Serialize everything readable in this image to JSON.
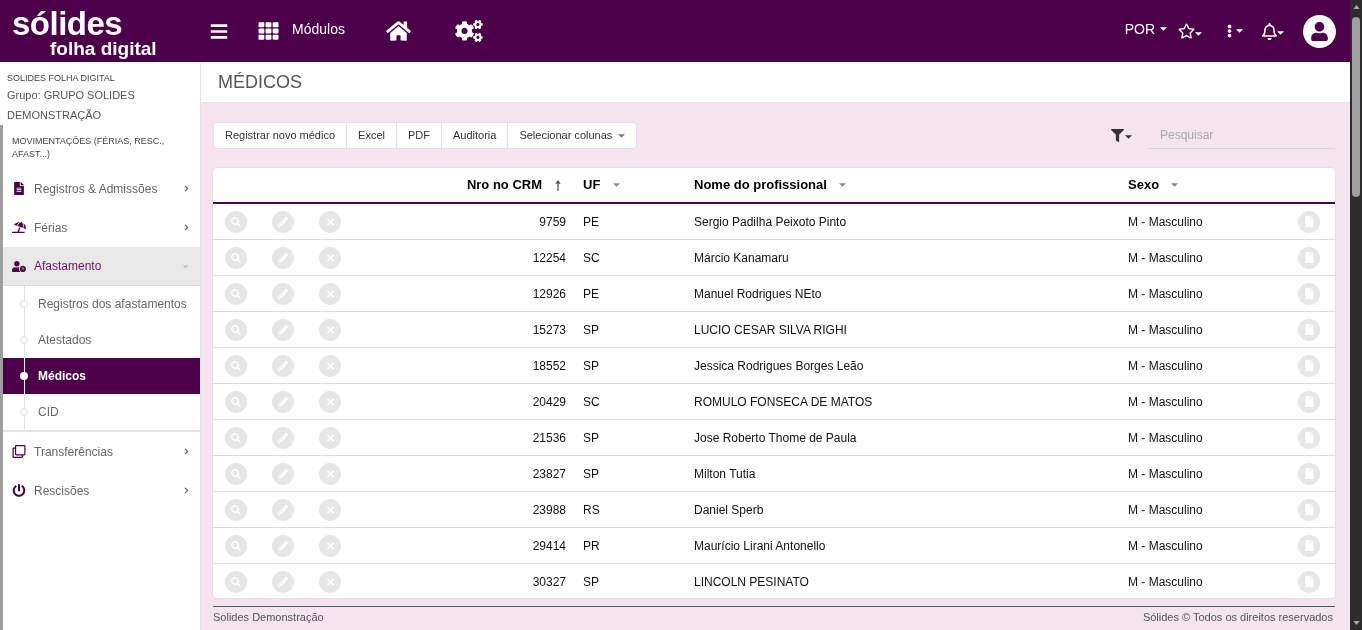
{
  "header": {
    "logo": {
      "name": "sólides",
      "tagline": "folha digital"
    },
    "modules_label": "Módulos",
    "language": "POR"
  },
  "sidebar": {
    "app_name": "SOLIDES FOLHA DIGITAL",
    "group": "Grupo: GRUPO SOLIDES DEMONSTRAÇÃO",
    "section": "MOVIMENTAÇÕES (FÉRIAS, RESC., AFAST...)",
    "items": [
      {
        "label": "Registros & Admissões",
        "expanded": false
      },
      {
        "label": "Férias",
        "expanded": false
      },
      {
        "label": "Afastamento",
        "expanded": true,
        "children": [
          {
            "label": "Registros dos afastamentos",
            "selected": false
          },
          {
            "label": "Atestados",
            "selected": false
          },
          {
            "label": "Médicos",
            "selected": true
          },
          {
            "label": "CID",
            "selected": false
          }
        ]
      },
      {
        "label": "Transferências",
        "expanded": false
      },
      {
        "label": "Rescisões",
        "expanded": false
      }
    ]
  },
  "page": {
    "title": "MÉDICOS"
  },
  "toolbar": {
    "buttons": [
      {
        "label": "Registrar novo médico",
        "kind": "button"
      },
      {
        "label": "Excel",
        "kind": "button"
      },
      {
        "label": "PDF",
        "kind": "button"
      },
      {
        "label": "Auditoria",
        "kind": "button"
      },
      {
        "label": "Selecionar colunas",
        "kind": "dropdown"
      }
    ],
    "search": {
      "placeholder": "Pesquisar"
    }
  },
  "table": {
    "columns": [
      {
        "label": "Nro no CRM",
        "sorted": true
      },
      {
        "label": "UF",
        "sorted": false
      },
      {
        "label": "Nome do profissional",
        "sorted": false
      },
      {
        "label": "Sexo",
        "sorted": false
      }
    ],
    "rows": [
      {
        "crm": "9759",
        "uf": "PE",
        "name": "Sergio Padilha Peixoto Pinto",
        "sex": "M - Masculino"
      },
      {
        "crm": "12254",
        "uf": "SC",
        "name": "Márcio Kanamaru",
        "sex": "M - Masculino"
      },
      {
        "crm": "12926",
        "uf": "PE",
        "name": "Manuel Rodrigues NEto",
        "sex": "M - Masculino"
      },
      {
        "crm": "15273",
        "uf": "SP",
        "name": "LUCIO CESAR SILVA RIGHI",
        "sex": "M - Masculino"
      },
      {
        "crm": "18552",
        "uf": "SP",
        "name": "Jessica Rodrigues Borges Leão",
        "sex": "M - Masculino"
      },
      {
        "crm": "20429",
        "uf": "SC",
        "name": "ROMULO FONSECA DE MATOS",
        "sex": "M - Masculino"
      },
      {
        "crm": "21536",
        "uf": "SP",
        "name": "Jose Roberto Thome de Paula",
        "sex": "M - Masculino"
      },
      {
        "crm": "23827",
        "uf": "SP",
        "name": "Milton Tutia",
        "sex": "M - Masculino"
      },
      {
        "crm": "23988",
        "uf": "RS",
        "name": "Daniel Sperb",
        "sex": "M - Masculino"
      },
      {
        "crm": "29414",
        "uf": "PR",
        "name": "Maurício Lirani Antonello",
        "sex": "M - Masculino"
      },
      {
        "crm": "30327",
        "uf": "SP",
        "name": "LINCOLN PESINATO",
        "sex": "M - Masculino"
      }
    ]
  },
  "footer": {
    "left": "Solides Demonstração",
    "right": "Sólides © Todos os direitos reservados"
  }
}
